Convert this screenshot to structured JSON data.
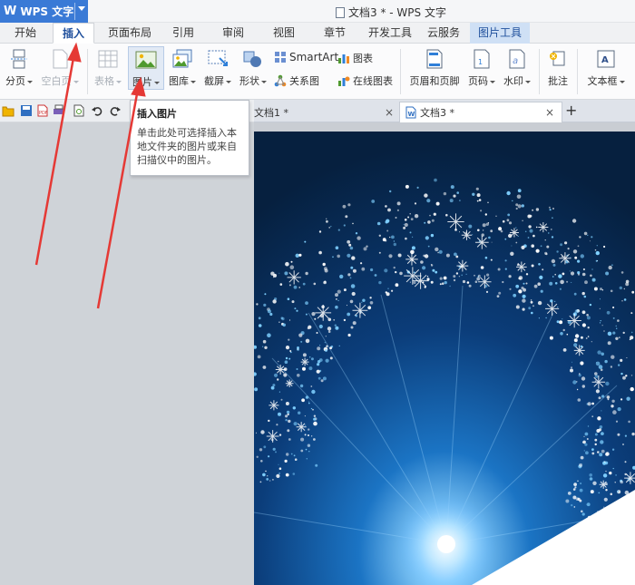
{
  "app": {
    "logo_glyph": "W",
    "name": "WPS 文字"
  },
  "window_title": "文档3 * - WPS 文字",
  "ribbon_tabs": [
    "开始",
    "插入",
    "页面布局",
    "引用",
    "审阅",
    "视图",
    "章节",
    "开发工具",
    "云服务",
    "图片工具"
  ],
  "active_tab": "插入",
  "ribbon": {
    "page_break": "分页",
    "blank_page": "空白页",
    "table": "表格",
    "picture": "图片",
    "gallery": "图库",
    "screenshot": "截屏",
    "shapes": "形状",
    "smartart": "SmartArt",
    "chart": "图表",
    "relation": "关系图",
    "online_chart": "在线图表",
    "header_footer": "页眉和页脚",
    "page_number": "页码",
    "watermark": "水印",
    "comment": "批注",
    "textbox": "文本框"
  },
  "doc_tabs": [
    {
      "label": "文档1 *"
    },
    {
      "label": "文档3 *"
    }
  ],
  "tooltip": {
    "title": "插入图片",
    "body_lines": [
      "单击此处可选择插入本",
      "地文件夹的图片或来自",
      "扫描仪中的图片。"
    ]
  },
  "colors": {
    "app_blue": "#3a7ad6",
    "active_tab_text": "#1f4f9c",
    "picture_tools_tab": "#cfe0f5",
    "arrow_red": "#e53935",
    "image_deep_blue": "#0a2a55"
  },
  "icons": [
    "page-break-icon",
    "blank-page-icon",
    "table-icon",
    "picture-icon",
    "gallery-icon",
    "screenshot-icon",
    "shapes-icon",
    "smartart-icon",
    "chart-icon",
    "relation-icon",
    "online-chart-icon",
    "header-footer-icon",
    "page-number-icon",
    "watermark-icon",
    "comment-icon",
    "textbox-icon"
  ]
}
